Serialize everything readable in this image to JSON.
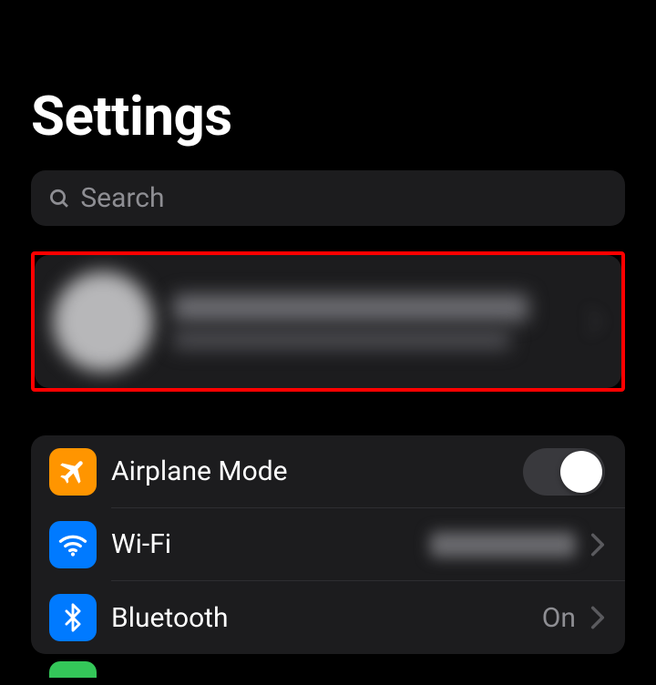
{
  "title": "Settings",
  "search": {
    "placeholder": "Search"
  },
  "account": {
    "name": "",
    "subtitle": ""
  },
  "rows": {
    "airplane": {
      "label": "Airplane Mode",
      "on": false
    },
    "wifi": {
      "label": "Wi-Fi",
      "value": ""
    },
    "bluetooth": {
      "label": "Bluetooth",
      "value": "On"
    }
  },
  "colors": {
    "highlight": "#ff0000"
  }
}
